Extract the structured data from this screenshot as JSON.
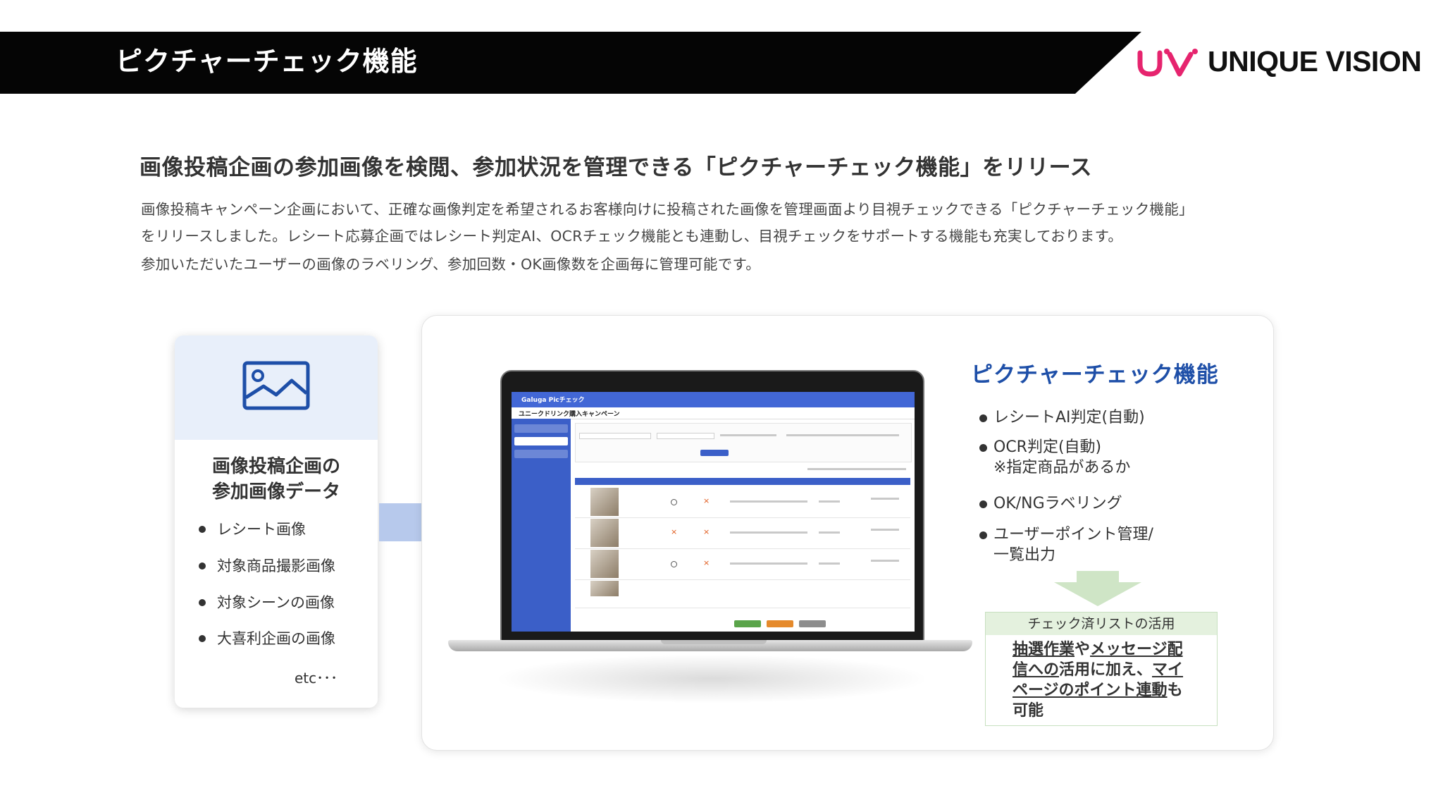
{
  "header": {
    "title": "ピクチャーチェック機能",
    "logo_text": "UNIQUE VISION"
  },
  "intro": {
    "headline": "画像投稿企画の参加画像を検閲、参加状況を管理できる「ピクチャーチェック機能」をリリース",
    "description_lines": [
      "画像投稿キャンペーン企画において、正確な画像判定を希望されるお客様向けに投稿された画像を管理画面より目視チェックできる「ピクチャーチェック機能」",
      "をリリースしました。レシート応募企画ではレシート判定AI、OCRチェック機能とも連動し、目視チェックをサポートする機能も充実しております。",
      "参加いただいたユーザーの画像のラベリング、参加回数・OK画像数を企画毎に管理可能です。"
    ]
  },
  "left_card": {
    "title_lines": [
      "画像投稿企画の",
      "参加画像データ"
    ],
    "items": [
      "レシート画像",
      "対象商品撮影画像",
      "対象シーンの画像",
      "大喜利企画の画像"
    ],
    "etc": "etc･･･"
  },
  "laptop_screen": {
    "brand": "Galuga Picチェック",
    "campaign_title": "ユニークドリンク購入キャンペーン"
  },
  "right_panel": {
    "title": "ピクチャーチェック機能",
    "features": [
      {
        "line1": "レシートAI判定(自動)"
      },
      {
        "line1": "OCR判定(自動)",
        "line2": "※指定商品があるか"
      },
      {
        "line1": "OK/NGラベリング"
      },
      {
        "line1": "ユーザーポイント管理/",
        "line2": "一覧出力"
      }
    ],
    "check_box": {
      "heading": "チェック済リストの活用",
      "segments": [
        {
          "text": "抽選作業",
          "underline": true
        },
        {
          "text": "や",
          "underline": false
        },
        {
          "text": "メッセージ配信",
          "underline": true
        },
        {
          "text": "への",
          "underline": false
        },
        {
          "text": "活用に加え、",
          "underline": false
        },
        {
          "text": "マイページのポイント連動",
          "underline": true
        },
        {
          "text": "も可能",
          "underline": false
        }
      ]
    }
  },
  "colors": {
    "header_bg": "#050505",
    "accent_blue": "#1e4fa8",
    "logo_pink": "#e6246e",
    "check_green": "#e4f1de"
  }
}
